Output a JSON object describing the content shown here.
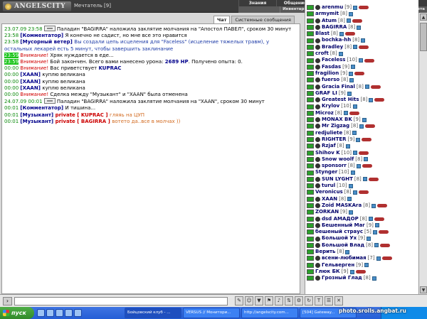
{
  "header": {
    "logo": "ANGELSCITY",
    "char_name": "Мечтатель [9]",
    "menu_top": [
      "Знания",
      "Общение",
      "Безопасность",
      "Персонаж",
      "Выход"
    ],
    "menu_sub": [
      "Инвентарь",
      "Умения",
      "Отчет о переводах",
      "Поединки",
      "Анкета"
    ]
  },
  "tabs": [
    "Чат",
    "Системные сообщения"
  ],
  "chat": [
    {
      "ts": "23.07.09 23:58",
      "icon": true,
      "parts": [
        {
          "t": "Паладин \"BAGIRRA\" наложила заклятие молчания на \"Апостол ПАВЕЛ\", сроком 30 минут",
          "c": ""
        }
      ]
    },
    {
      "ts": "23:58",
      "parts": [
        {
          "t": "[Комментатор] ",
          "c": "sender"
        },
        {
          "t": "Я конечно не садист, но мне все это нравится",
          "c": ""
        }
      ]
    },
    {
      "ts": "23:58",
      "wrap": true,
      "parts": [
        {
          "t": "[Мусорный ветер] ",
          "c": "sender"
        },
        {
          "t": "Вы создали цепь исцеления для \"Faceless\" (исцеление тяжелых травм), у остальных лекарей есть 5 минут, чтобы завершить заклинание",
          "c": "blue"
        }
      ]
    },
    {
      "ts": "23:59",
      "hl": true,
      "parts": [
        {
          "t": "Внимание! ",
          "c": "warn"
        },
        {
          "t": "Хряк нуждается в еде...",
          "c": ""
        }
      ]
    },
    {
      "ts": "23:59",
      "hl": true,
      "parts": [
        {
          "t": "Внимание! ",
          "c": "warn"
        },
        {
          "t": "Бой закончен. Всего вами нанесено урона: ",
          "c": ""
        },
        {
          "t": "2689 HP",
          "c": "sender"
        },
        {
          "t": ". Получено опыта: 0.",
          "c": ""
        }
      ]
    },
    {
      "ts": "00:00",
      "parts": [
        {
          "t": "Внимание! ",
          "c": "warn"
        },
        {
          "t": "Вас приветствует ",
          "c": ""
        },
        {
          "t": "KUPRAC",
          "c": "sender"
        }
      ]
    },
    {
      "ts": "00:00",
      "parts": [
        {
          "t": "[XAAN] ",
          "c": "sender"
        },
        {
          "t": "куплю великана",
          "c": ""
        }
      ]
    },
    {
      "ts": "00:00",
      "parts": [
        {
          "t": "[XAAN] ",
          "c": "sender"
        },
        {
          "t": "куплю великана",
          "c": ""
        }
      ]
    },
    {
      "ts": "00:00",
      "parts": [
        {
          "t": "[XAAN] ",
          "c": "sender"
        },
        {
          "t": "куплю великана",
          "c": ""
        }
      ]
    },
    {
      "ts": "00:00",
      "parts": [
        {
          "t": "Внимание! ",
          "c": "warn"
        },
        {
          "t": "Сделка между \"Музыкант\" и \"XAAN\" была отменена",
          "c": ""
        }
      ]
    },
    {
      "ts": "24.07.09 00:01",
      "icon": true,
      "parts": [
        {
          "t": "Паладин \"BAGIRRA\" наложила заклятие молчания на \"XAAN\", сроком 30 минут",
          "c": ""
        }
      ]
    },
    {
      "ts": "00:01",
      "parts": [
        {
          "t": "[Комментатор] ",
          "c": "sender"
        },
        {
          "t": "И тишина...",
          "c": ""
        }
      ]
    },
    {
      "ts": "00:01",
      "parts": [
        {
          "t": "[Музыкант] ",
          "c": "sender"
        },
        {
          "t": "private [ KUPRAC ] ",
          "c": "priv"
        },
        {
          "t": "гляяь на ЦУП",
          "c": "ptext"
        }
      ]
    },
    {
      "ts": "00:01",
      "parts": [
        {
          "t": "[Музыкант] ",
          "c": "sender"
        },
        {
          "t": "private [ BAGIRRA ] ",
          "c": "priv"
        },
        {
          "t": "вотето да..все в молчах ))",
          "c": "ptext"
        }
      ]
    }
  ],
  "users": [
    {
      "name": "arenmu",
      "lvl": "[9]"
    },
    {
      "name": "armymit",
      "lvl": "[8]"
    },
    {
      "name": "Atum",
      "lvl": "[8]"
    },
    {
      "name": "BAGIRRA",
      "lvl": "[8]"
    },
    {
      "name": "Blast",
      "lvl": "[8]"
    },
    {
      "name": "bochka-hh",
      "lvl": "[8]"
    },
    {
      "name": "Bradley",
      "lvl": "[8]"
    },
    {
      "name": "croft",
      "lvl": "[8]"
    },
    {
      "name": "Faceless",
      "lvl": "[10]"
    },
    {
      "name": "Fasdas",
      "lvl": "[9]"
    },
    {
      "name": "fragilion",
      "lvl": "[9]"
    },
    {
      "name": "fuerso",
      "lvl": "[8]"
    },
    {
      "name": "Gracia Final",
      "lvl": "[8]"
    },
    {
      "name": "GRAF LI",
      "lvl": "[9]"
    },
    {
      "name": "Greatest Hits",
      "lvl": "[8]"
    },
    {
      "name": "Krylov",
      "lvl": "[10]"
    },
    {
      "name": "Microz",
      "lvl": "[8]"
    },
    {
      "name": "MONAX BK",
      "lvl": "[9]"
    },
    {
      "name": "Mr Zigzag",
      "lvl": "[8]"
    },
    {
      "name": "redjuliete",
      "lvl": "[8]"
    },
    {
      "name": "RIGHTER",
      "lvl": "[9]"
    },
    {
      "name": "Rzjaf",
      "lvl": "[8]"
    },
    {
      "name": "Shihov K",
      "lvl": "[10]"
    },
    {
      "name": "Snow woolf",
      "lvl": "[8]"
    },
    {
      "name": "sponsorr",
      "lvl": "[8]"
    },
    {
      "name": "Stynger",
      "lvl": "[10]"
    },
    {
      "name": "SUN LYGHT",
      "lvl": "[8]"
    },
    {
      "name": "turul",
      "lvl": "[10]"
    },
    {
      "name": "Veronicus",
      "lvl": "[8]"
    },
    {
      "name": "XAAN",
      "lvl": "[8]"
    },
    {
      "name": "Zoid MASKAra",
      "lvl": "[8]"
    },
    {
      "name": "ZORKAN",
      "lvl": "[9]"
    },
    {
      "name": "dsd АМАДОР",
      "lvl": "[8]"
    },
    {
      "name": "Бешенный Маг",
      "lvl": "[9]"
    },
    {
      "name": "бешеный страус",
      "lvl": "[5]"
    },
    {
      "name": "Большой Ух",
      "lvl": "[9]"
    },
    {
      "name": "Большой Влад",
      "lvl": "[8]"
    },
    {
      "name": "Верить",
      "lvl": "[8]"
    },
    {
      "name": "всени-любимая",
      "lvl": "[7]"
    },
    {
      "name": "Гельверген",
      "lvl": "[9]"
    },
    {
      "name": "Глюк БК",
      "lvl": "[9]"
    },
    {
      "name": "Грозный Глад",
      "lvl": "[8]"
    }
  ],
  "taskbar": {
    "start": "пуск",
    "tasks": [
      "Бойцовский клуб - ...",
      "VERSUS // Монитори...",
      "http://angelscity.com...",
      "[504] Gateway..."
    ]
  },
  "watermark": "photo.srolls.angbat.ru"
}
